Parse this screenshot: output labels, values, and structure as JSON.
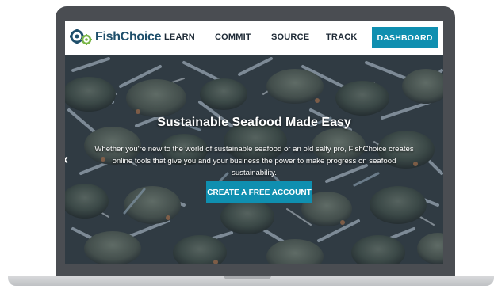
{
  "logo": {
    "text": "FishChoice"
  },
  "nav": {
    "items": [
      {
        "label": "LEARN"
      },
      {
        "label": "COMMIT"
      },
      {
        "label": "SOURCE"
      },
      {
        "label": "TRACK"
      }
    ],
    "dashboard_label": "DASHBOARD"
  },
  "hero": {
    "title": "Sustainable Seafood Made Easy",
    "subtitle": "Whether you're new to the world of sustainable seafood or an old salty pro, FishChoice creates online tools that give you and your business the power to make progress on seafood sustainability.",
    "cta_label": "CREATE A FREE ACCOUNT",
    "prev_arrow": "‹"
  },
  "colors": {
    "accent": "#0f8fb0",
    "logo_text": "#1f4f6b",
    "logo_green": "#7ab648",
    "frame": "#4a4d52"
  }
}
